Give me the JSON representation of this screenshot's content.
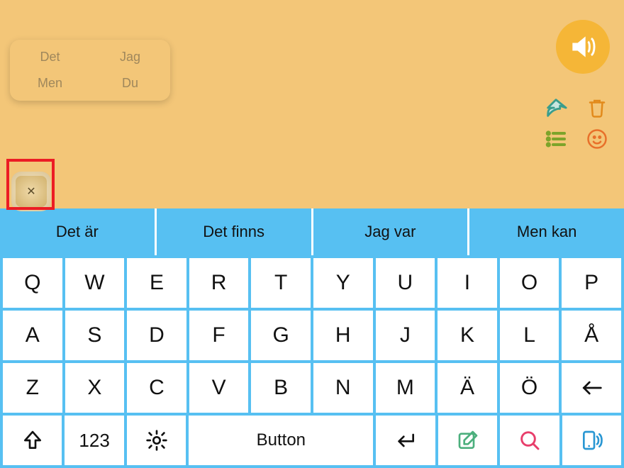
{
  "suggestions": {
    "a": "Det",
    "b": "Jag",
    "c": "Men",
    "d": "Du"
  },
  "phrases": [
    "Det är",
    "Det finns",
    "Jag var",
    "Men kan"
  ],
  "keyboard": {
    "row1": [
      "Q",
      "W",
      "E",
      "R",
      "T",
      "Y",
      "U",
      "I",
      "O",
      "P"
    ],
    "row2": [
      "A",
      "S",
      "D",
      "F",
      "G",
      "H",
      "J",
      "K",
      "L",
      "Å"
    ],
    "row3": [
      "Z",
      "X",
      "C",
      "V",
      "B",
      "N",
      "M",
      "Ä",
      "Ö"
    ]
  },
  "bottom": {
    "num_label": "123",
    "space_label": "Button"
  },
  "colors": {
    "top_bg": "#f3c678",
    "accent_blue": "#57c0f2",
    "share_teal": "#3a9d8d",
    "trash_orange": "#e28a1b",
    "list_green": "#7da42a",
    "smiley_orange": "#e8702a",
    "search_pink": "#e83e6b",
    "edit_green": "#4caf7d",
    "speak_yellow": "#f5b637",
    "red_highlight": "#ec1c24"
  }
}
